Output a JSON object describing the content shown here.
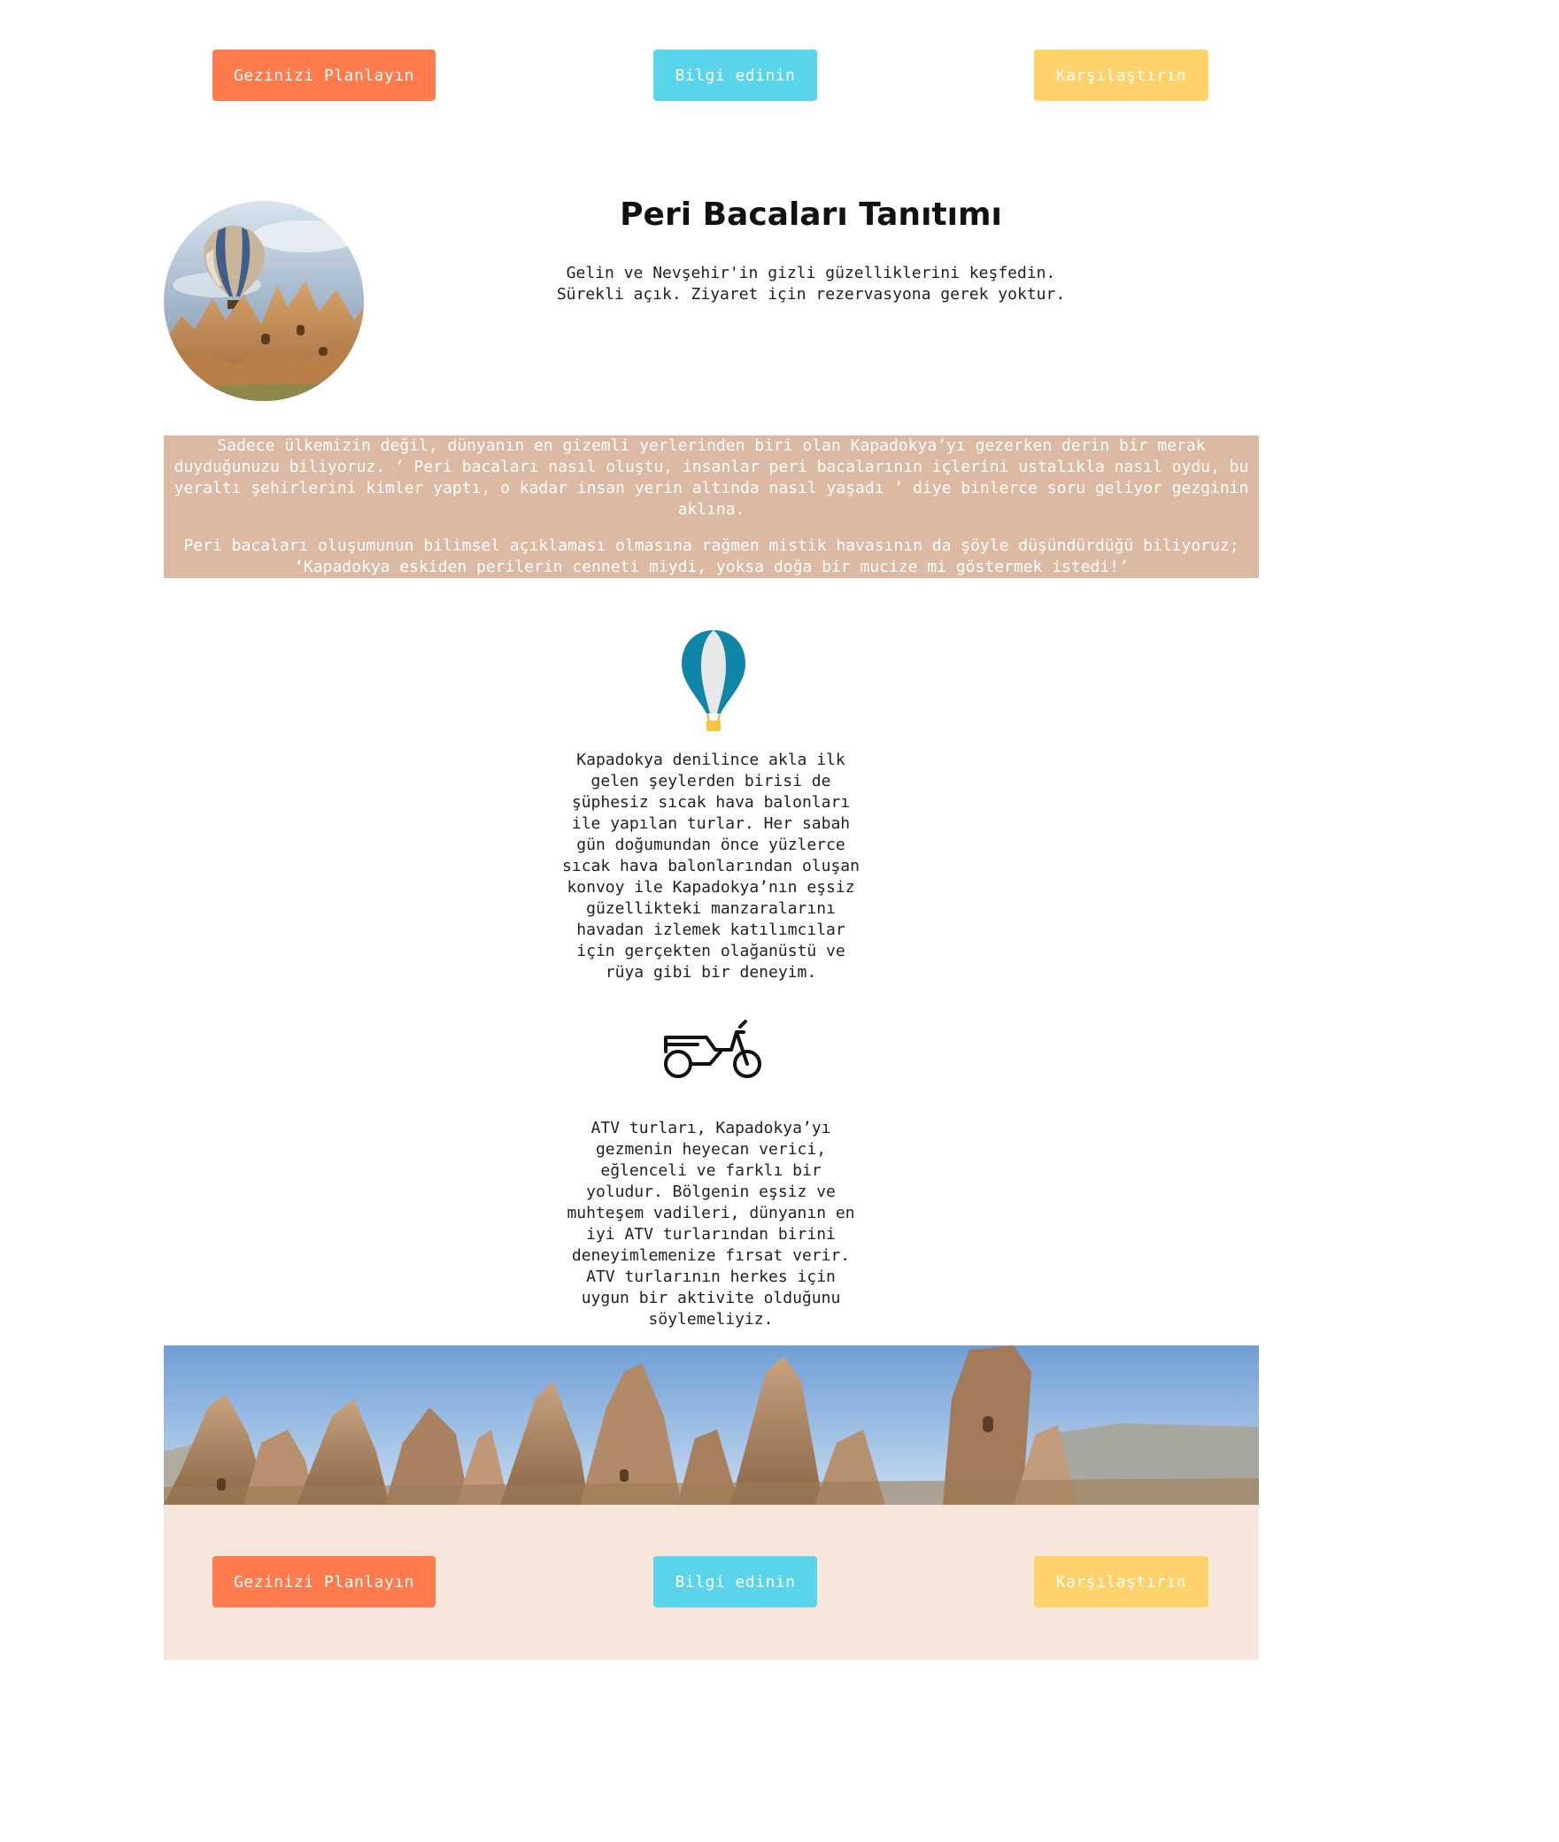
{
  "colors": {
    "plan_button": "#ff7a4d",
    "info_button": "#5ad4ea",
    "compare_button": "#ffd26b",
    "intro_box_bg": "#dcb9a3",
    "footer_bg": "#f7e6dc"
  },
  "top_nav": {
    "plan_label": "Gezinizi Planlayın",
    "info_label": "Bilgi edinin",
    "compare_label": "Karşılaştırın"
  },
  "hero": {
    "image": "hot-air-balloon-over-fairy-chimneys",
    "title": "Peri Bacaları Tanıtımı",
    "subtitle_line1": "Gelin ve Nevşehir'in gizli güzelliklerini keşfedin.",
    "subtitle_line2": "Sürekli açık. Ziyaret için rezervasyona gerek yoktur."
  },
  "intro": {
    "paragraph1": "Sadece ülkemizin değil, dünyanın en gizemli yerlerinden biri olan Kapadokya’yı gezerken derin bir merak duyduğunuzu biliyoruz. ‘ Peri bacaları nasıl oluştu, insanlar peri bacalarının içlerini ustalıkla nasıl oydu, bu yeraltı şehirlerini kimler yaptı, o kadar insan yerin altında nasıl yaşadı ’ diye binlerce soru geliyor gezginin aklına.",
    "paragraph2": "Peri bacaları oluşumunun bilimsel açıklaması olmasına rağmen mistik havasının da şöyle düşündürdüğü biliyoruz; ‘Kapadokya eskiden perilerin cenneti miydi, yoksa doğa bir mucize mi göstermek istedi!’"
  },
  "features": [
    {
      "icon": "hot-air-balloon-icon",
      "lines": [
        "Kapadokya denilince akla ilk",
        "gelen şeylerden birisi de",
        "şüphesiz sıcak hava balonları",
        "ile yapılan turlar. Her sabah",
        "gün doğumundan önce yüzlerce",
        "sıcak hava balonlarından oluşan",
        "konvoy ile Kapadokya’nın eşsiz",
        "güzellikteki manzaralarını",
        "havadan izlemek katılımcılar",
        "için gerçekten olağanüstü ve",
        "rüya gibi bir deneyim."
      ]
    },
    {
      "icon": "atv-icon",
      "lines": [
        "ATV turları, Kapadokya’yı",
        "gezmenin heyecan verici,",
        "eğlenceli ve farklı bir",
        "yoludur. Bölgenin eşsiz ve",
        "muhteşem vadileri, dünyanın en",
        "iyi ATV turlarından birini",
        "deneyimlemenize fırsat verir.",
        "ATV turlarının herkes için",
        "uygun bir aktivite olduğunu",
        "söylemeliyiz."
      ]
    }
  ],
  "banner": {
    "image": "fairy-chimneys-panorama"
  },
  "footer_nav": {
    "plan_label": "Gezinizi Planlayın",
    "info_label": "Bilgi edinin",
    "compare_label": "Karşılaştırın"
  }
}
